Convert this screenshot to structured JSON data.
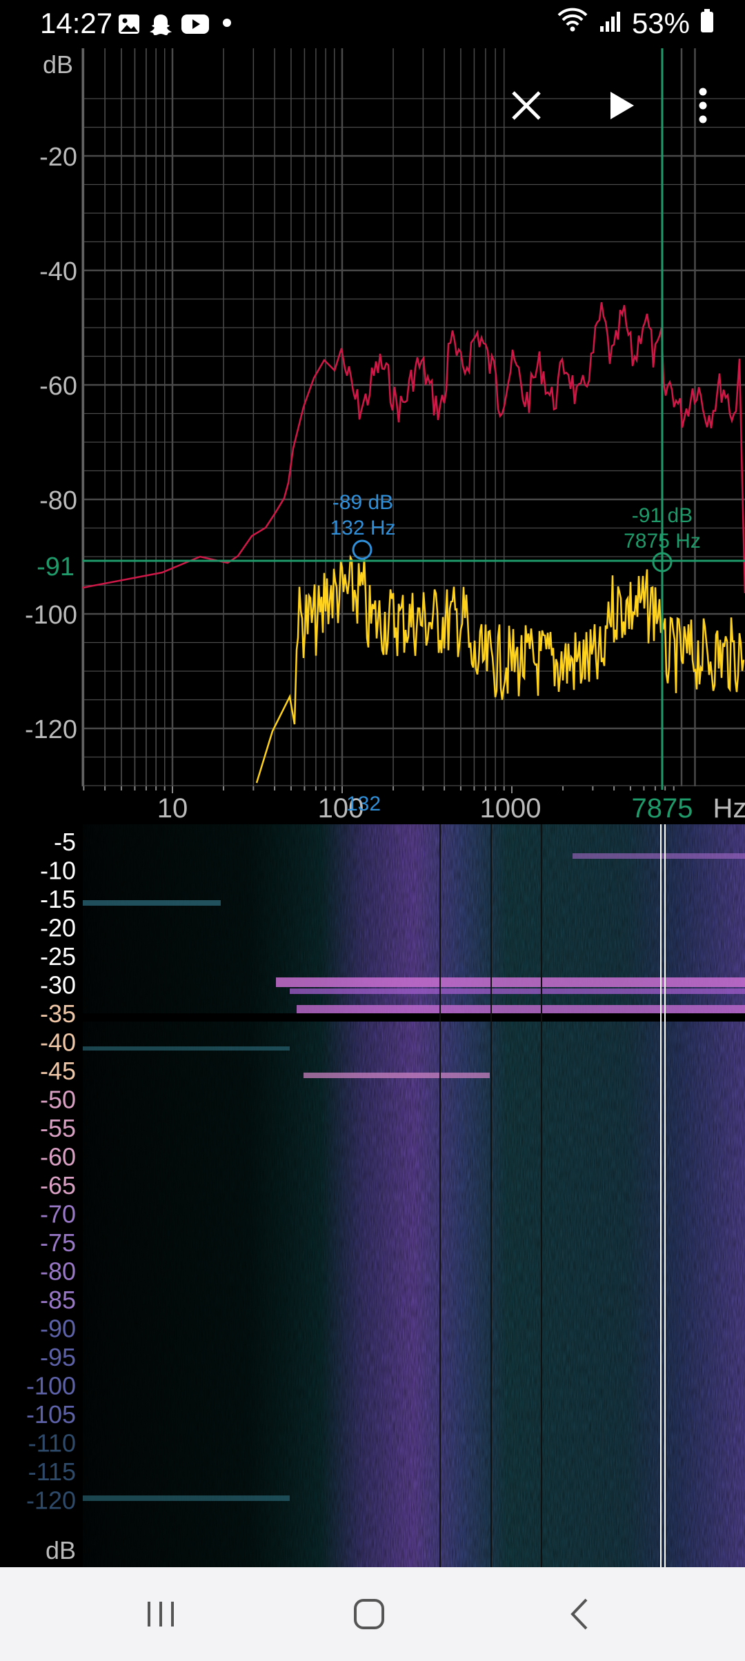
{
  "status_bar": {
    "time": "14:27",
    "battery": "53%",
    "icons": [
      "gallery-icon",
      "snapchat-icon",
      "youtube-icon",
      "dot-icon",
      "wifi-icon",
      "signal-icon",
      "battery-icon"
    ]
  },
  "toolbar": {
    "close_icon": "close-icon",
    "play_icon": "play-icon",
    "menu_icon": "more-vert-icon"
  },
  "spectrum": {
    "y_unit": "dB",
    "y_ticks": [
      "-20",
      "-40",
      "-60",
      "-80",
      "-100",
      "-120"
    ],
    "x_ticks": [
      "10",
      "100",
      "1000"
    ],
    "x_unit": "Hz",
    "cursor_y_label": "-91",
    "cursor_x_label": "7875",
    "marker_peak": {
      "db": "-89 dB",
      "hz": "132 Hz",
      "x_label": "132"
    },
    "marker_cursor": {
      "db": "-91 dB",
      "hz": "7875 Hz"
    },
    "colors": {
      "red_trace": "#d01848",
      "yellow_trace": "#ffd21e",
      "cursor": "#1f9a6a",
      "marker_blue": "#2f8fd8",
      "grid": "#4a4a4a"
    }
  },
  "spectrogram": {
    "y_ticks": [
      "-5",
      "-10",
      "-15",
      "-20",
      "-25",
      "-30",
      "-35",
      "-40",
      "-45",
      "-50",
      "-55",
      "-60",
      "-65",
      "-70",
      "-75",
      "-80",
      "-85",
      "-90",
      "-95",
      "-100",
      "-105",
      "-110",
      "-115",
      "-120"
    ],
    "y_unit": "dB"
  },
  "navbar": {
    "recent_icon": "recent-apps-icon",
    "home_icon": "home-icon",
    "back_icon": "back-icon"
  }
}
